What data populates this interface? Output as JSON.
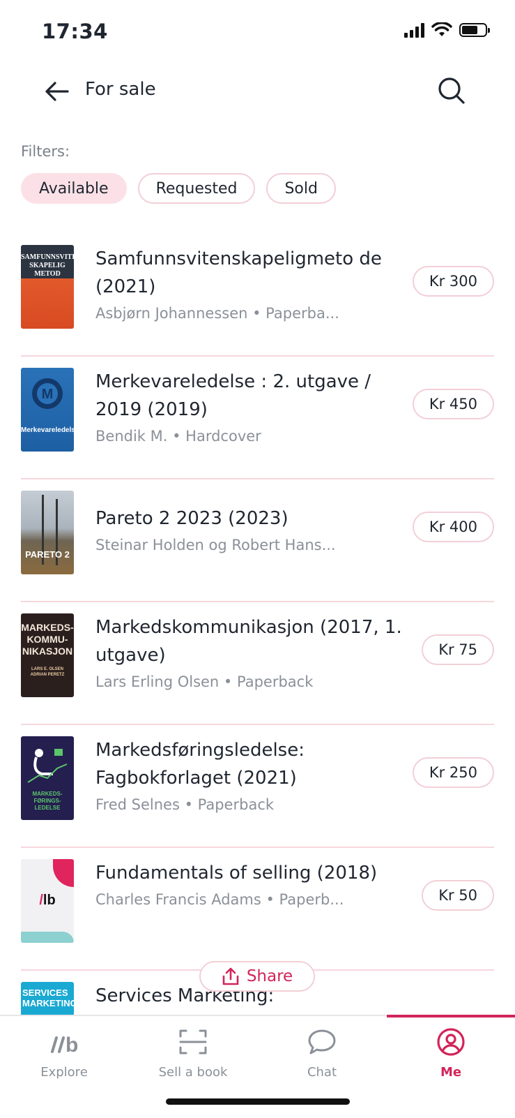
{
  "status": {
    "time": "17:34"
  },
  "header": {
    "title": "For sale"
  },
  "filters": {
    "label": "Filters:",
    "chips": [
      "Available",
      "Requested",
      "Sold"
    ],
    "active": "Available"
  },
  "listings": [
    {
      "title": "Samfunnsvitenskapeligmeto de (2021)",
      "meta": "Asbjørn Johannessen • Paperba...",
      "price": "Kr 300"
    },
    {
      "title": "Merkevareledelse : 2. utgave / 2019 (2019)",
      "meta": "Bendik M. • Hardcover",
      "price": "Kr 450"
    },
    {
      "title": "Pareto 2 2023 (2023)",
      "meta": "Steinar Holden og Robert Hans...",
      "price": "Kr 400"
    },
    {
      "title": "Markedskommunikasjon (2017, 1. utgave)",
      "meta": "Lars Erling Olsen • Paperback",
      "price": "Kr 75"
    },
    {
      "title": "Markedsføringsledelse: Fagbokforlaget (2021)",
      "meta": "Fred Selnes • Paperback",
      "price": "Kr 250"
    },
    {
      "title": "Fundamentals of selling (2018)",
      "meta": "Charles Francis Adams • Paperb...",
      "price": "Kr 50"
    },
    {
      "title": "Services Marketing:",
      "meta": "",
      "price": ""
    }
  ],
  "covers": {
    "c1": [
      "SAMFUNNSVITEN",
      "SKAPELIG METOD"
    ],
    "c2": [
      "Merkevareledelse"
    ],
    "c3": [
      "PARETO 2"
    ],
    "c4": [
      "MARKEDS-",
      "KOMMU-",
      "NIKASJON",
      "LARS E. OLSEN",
      "ADRIAN PERETZ"
    ],
    "c5": [
      "MARKEDS-",
      "FØRINGS-",
      "LEDELSE"
    ],
    "c6": [
      "lb"
    ],
    "c7": [
      "SERVICES",
      "MARKETING"
    ]
  },
  "share": {
    "label": "Share"
  },
  "nav": {
    "items": [
      {
        "label": "Explore"
      },
      {
        "label": "Sell a book"
      },
      {
        "label": "Chat"
      },
      {
        "label": "Me"
      }
    ],
    "active": "Me"
  },
  "colors": {
    "accent": "#d2245a",
    "chip_active": "#fbe1e7",
    "divider": "#f6d6dd"
  }
}
